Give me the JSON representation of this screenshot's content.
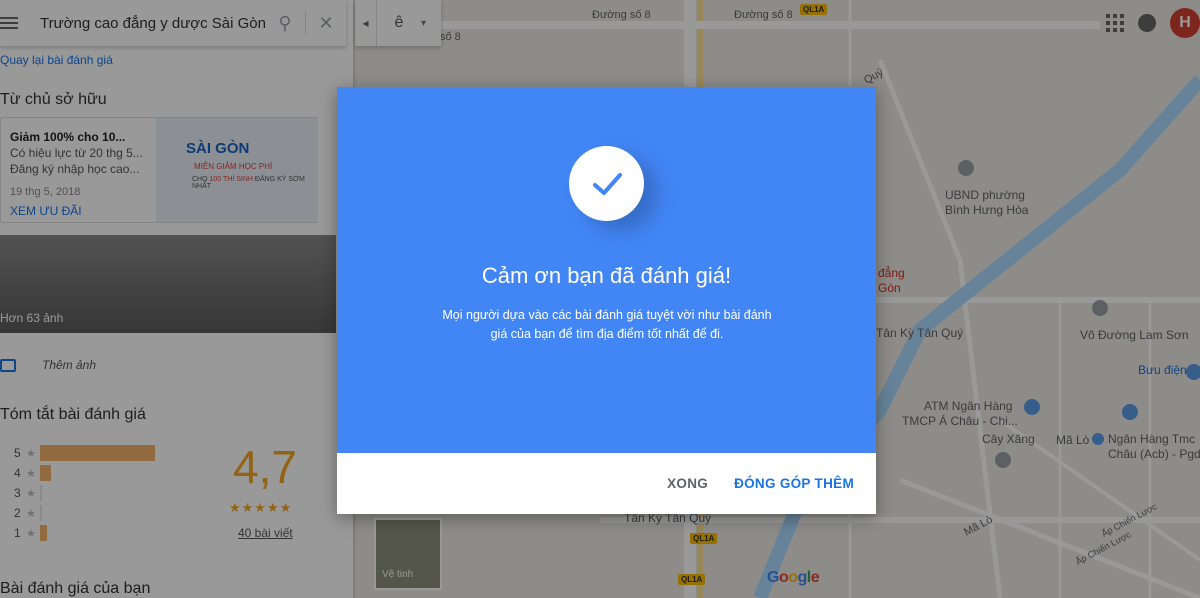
{
  "search": {
    "value": "Trường cao đẳng y dược Sài Gòn"
  },
  "back_link": "Quay lại bài đánh giá",
  "owner_section": {
    "title": "Từ chủ sở hữu",
    "offer": {
      "title": "Giảm 100% cho 10...",
      "line1": "Có hiệu lực từ 20 thg 5...",
      "line2": "Đăng ký nhập học cao...",
      "date": "19 thg 5, 2018",
      "link": "XEM ƯU ĐÃI",
      "banner_brand": "SÀI GÒN",
      "banner_red": "MIỄN GIẢM HỌC PHÍ",
      "banner_sub_prefix": "CHO",
      "banner_sub_red": "100 THÍ SINH",
      "banner_sub_suffix": "ĐĂNG KÝ SỚM NHẤT"
    }
  },
  "photos": {
    "caption": "Hơn 63 ảnh",
    "add_label": "Thêm ảnh"
  },
  "review_summary": {
    "title": "Tóm tắt bài đánh giá",
    "score": "4,7",
    "stars": "★★★★★",
    "count": "40 bài viết",
    "rows": [
      {
        "label": "5",
        "fraction": 0.82
      },
      {
        "label": "4",
        "fraction": 0.08
      },
      {
        "label": "3",
        "fraction": 0.0
      },
      {
        "label": "2",
        "fraction": 0.0
      },
      {
        "label": "1",
        "fraction": 0.05
      }
    ]
  },
  "your_review_title": "Bài đánh giá của bạn",
  "mini_toolbar": {
    "lang": "ê"
  },
  "user": {
    "avatar_letter": "H"
  },
  "map": {
    "labels": {
      "street1": "Đường số 8",
      "street2": "Đường số 8",
      "street3": "số 8",
      "qq": "Quý",
      "ubnd1": "UBND phường",
      "ubnd2": "Bình Hưng Hòa",
      "dang": "đẳng",
      "gon": "Gòn",
      "tan_ky1": "Tân Kỳ Tân Quý",
      "tan_ky2": "Tân Kỳ Tân Quý",
      "vo_duong": "Võ Đường Lam Sơn",
      "buu_dien": "Bưu điện",
      "atm1": "ATM Ngân Hàng",
      "atm2": "TMCP Á Châu - Chi...",
      "cay_xang": "Cây Xăng",
      "ma_lo": "Mã Lò",
      "nh1": "Ngân Hàng Tmc",
      "nh2": "Châu (Acb) - Pgd",
      "ma_lo_road": "Mã Lò",
      "ap_chien": "Ấp Chiến Lược",
      "ap_chien2": "Ấp Chiến Lược",
      "shield1": "QL1A",
      "shield2": "QL1A",
      "shield3": "QL1A",
      "satellite": "Vệ tinh",
      "google": "Google"
    }
  },
  "dialog": {
    "title": "Cảm ơn bạn đã đánh giá!",
    "description": "Mọi người dựa vào các bài đánh giá tuyệt vời như bài đánh giá của bạn để tìm địa điểm tốt nhất để đi.",
    "done_label": "XONG",
    "more_label": "ĐÓNG GÓP THÊM",
    "header_color": "#4285f4"
  }
}
